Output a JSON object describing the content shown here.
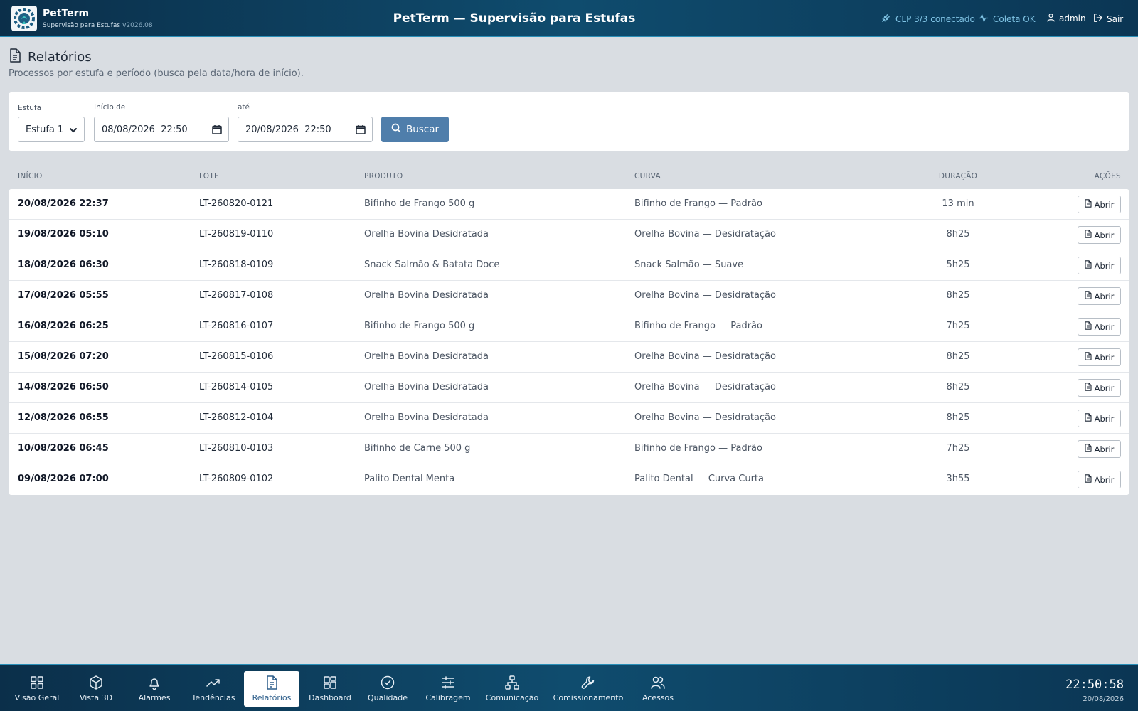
{
  "header": {
    "brand_name": "PetTerm",
    "brand_sub": "Supervisão para Estufas",
    "version": "v2026.08",
    "title": "PetTerm — Supervisão para Estufas",
    "clp_status": "CLP 3/3 conectado",
    "coleta_status": "Coleta OK",
    "user": "admin",
    "logout": "Sair",
    "status_color": "#7fc3e4"
  },
  "page": {
    "title": "Relatórios",
    "subtitle": "Processos por estufa e período (busca pela data/hora de início)."
  },
  "filters": {
    "estufa_label": "Estufa",
    "estufa_value": "Estufa 1",
    "inicio_label": "Início de",
    "inicio_value": "08/08/2026  22:50",
    "ate_label": "até",
    "ate_value": "20/08/2026  22:50",
    "search_button": "Buscar",
    "accent_color": "#4f7eab"
  },
  "table": {
    "headers": {
      "inicio": "INÍCIO",
      "lote": "LOTE",
      "produto": "PRODUTO",
      "curva": "CURVA",
      "duracao": "DURAÇÃO",
      "acoes": "AÇÕES"
    },
    "open_label": "Abrir",
    "rows": [
      {
        "inicio": "20/08/2026 22:37",
        "lote": "LT-260820-0121",
        "produto": "Bifinho de Frango 500 g",
        "curva": "Bifinho de Frango — Padrão",
        "duracao": "13 min"
      },
      {
        "inicio": "19/08/2026 05:10",
        "lote": "LT-260819-0110",
        "produto": "Orelha Bovina Desidratada",
        "curva": "Orelha Bovina — Desidratação",
        "duracao": "8h25"
      },
      {
        "inicio": "18/08/2026 06:30",
        "lote": "LT-260818-0109",
        "produto": "Snack Salmão & Batata Doce",
        "curva": "Snack Salmão — Suave",
        "duracao": "5h25"
      },
      {
        "inicio": "17/08/2026 05:55",
        "lote": "LT-260817-0108",
        "produto": "Orelha Bovina Desidratada",
        "curva": "Orelha Bovina — Desidratação",
        "duracao": "8h25"
      },
      {
        "inicio": "16/08/2026 06:25",
        "lote": "LT-260816-0107",
        "produto": "Bifinho de Frango 500 g",
        "curva": "Bifinho de Frango — Padrão",
        "duracao": "7h25"
      },
      {
        "inicio": "15/08/2026 07:20",
        "lote": "LT-260815-0106",
        "produto": "Orelha Bovina Desidratada",
        "curva": "Orelha Bovina — Desidratação",
        "duracao": "8h25"
      },
      {
        "inicio": "14/08/2026 06:50",
        "lote": "LT-260814-0105",
        "produto": "Orelha Bovina Desidratada",
        "curva": "Orelha Bovina — Desidratação",
        "duracao": "8h25"
      },
      {
        "inicio": "12/08/2026 06:55",
        "lote": "LT-260812-0104",
        "produto": "Orelha Bovina Desidratada",
        "curva": "Orelha Bovina — Desidratação",
        "duracao": "8h25"
      },
      {
        "inicio": "10/08/2026 06:45",
        "lote": "LT-260810-0103",
        "produto": "Bifinho de Carne 500 g",
        "curva": "Bifinho de Frango — Padrão",
        "duracao": "7h25"
      },
      {
        "inicio": "09/08/2026 07:00",
        "lote": "LT-260809-0102",
        "produto": "Palito Dental Menta",
        "curva": "Palito Dental — Curva Curta",
        "duracao": "3h55"
      }
    ]
  },
  "nav": {
    "active": "Relatórios",
    "items": [
      {
        "label": "Visão Geral",
        "icon": "grid-icon"
      },
      {
        "label": "Vista 3D",
        "icon": "cube-icon"
      },
      {
        "label": "Alarmes",
        "icon": "bell-icon"
      },
      {
        "label": "Tendências",
        "icon": "trending-up-icon"
      },
      {
        "label": "Relatórios",
        "icon": "document-icon"
      },
      {
        "label": "Dashboard",
        "icon": "dashboard-icon"
      },
      {
        "label": "Qualidade",
        "icon": "check-circle-icon"
      },
      {
        "label": "Calibragem",
        "icon": "sliders-icon"
      },
      {
        "label": "Comunicação",
        "icon": "network-icon"
      },
      {
        "label": "Comissionamento",
        "icon": "wrench-icon"
      },
      {
        "label": "Acessos",
        "icon": "users-icon"
      }
    ]
  },
  "clock": {
    "time": "22:50:58",
    "date": "20/08/2026"
  }
}
